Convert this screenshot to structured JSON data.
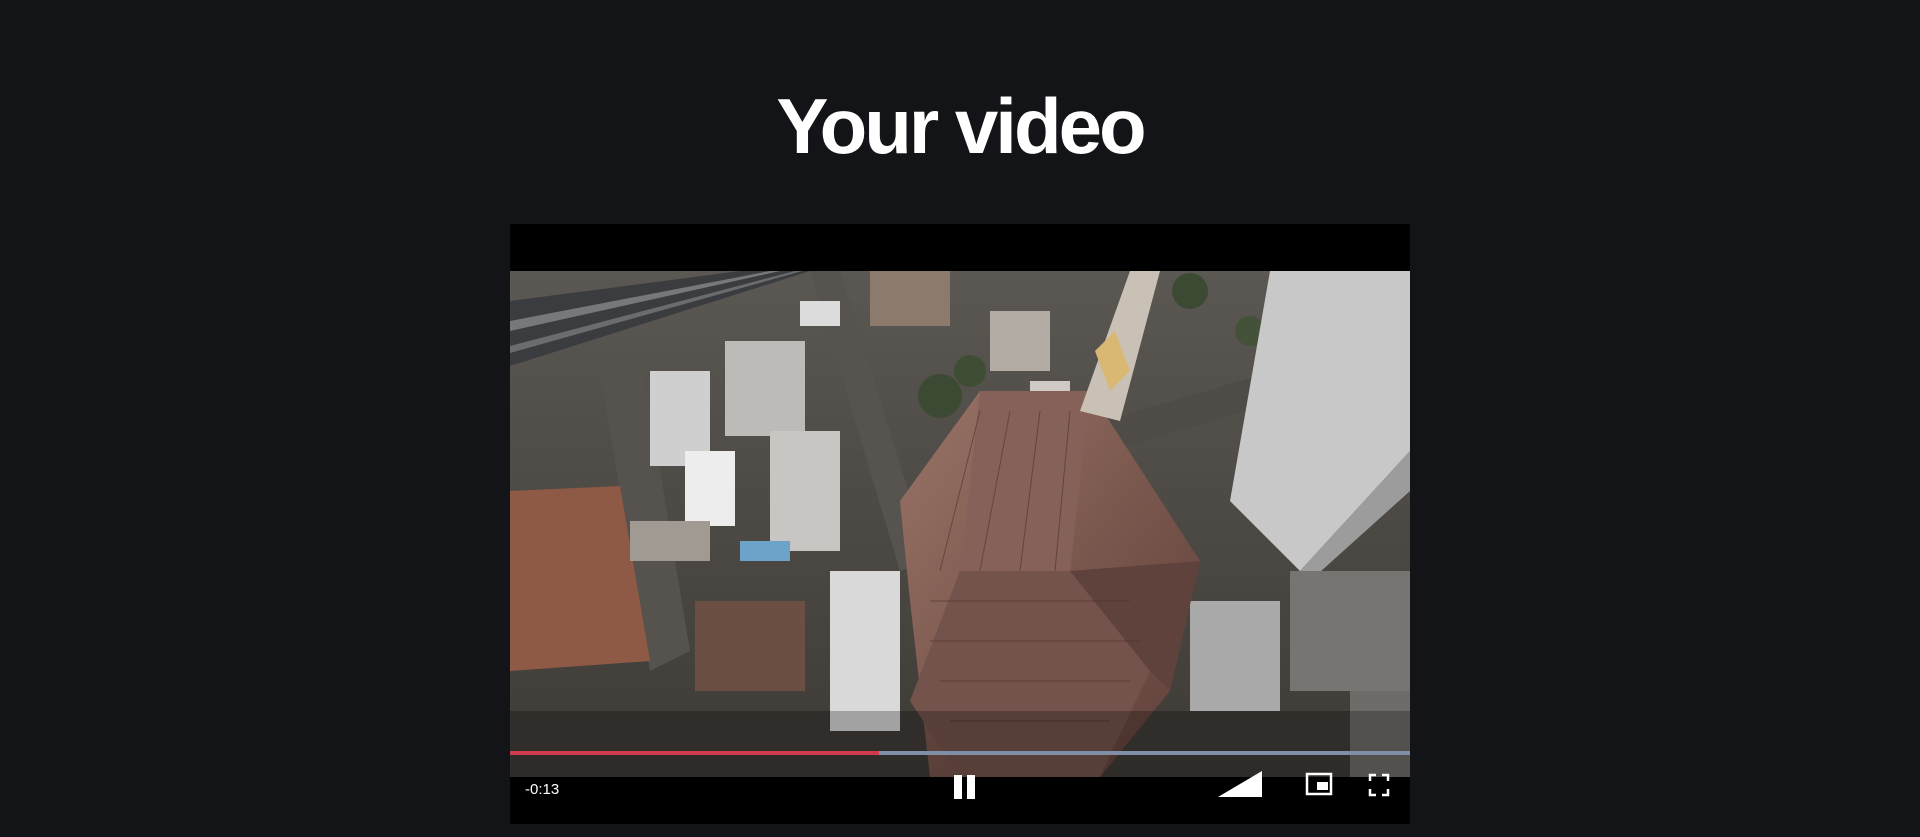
{
  "page": {
    "heading": "Your video"
  },
  "player": {
    "time_remaining": "-0:13",
    "progress_fraction": 0.41,
    "progress_color": "#d23a4f",
    "buffer_color": "#7f8fa8",
    "icons": {
      "pause": "pause-icon",
      "volume": "volume-icon",
      "pip": "picture-in-picture-icon",
      "fullscreen": "fullscreen-icon"
    }
  }
}
